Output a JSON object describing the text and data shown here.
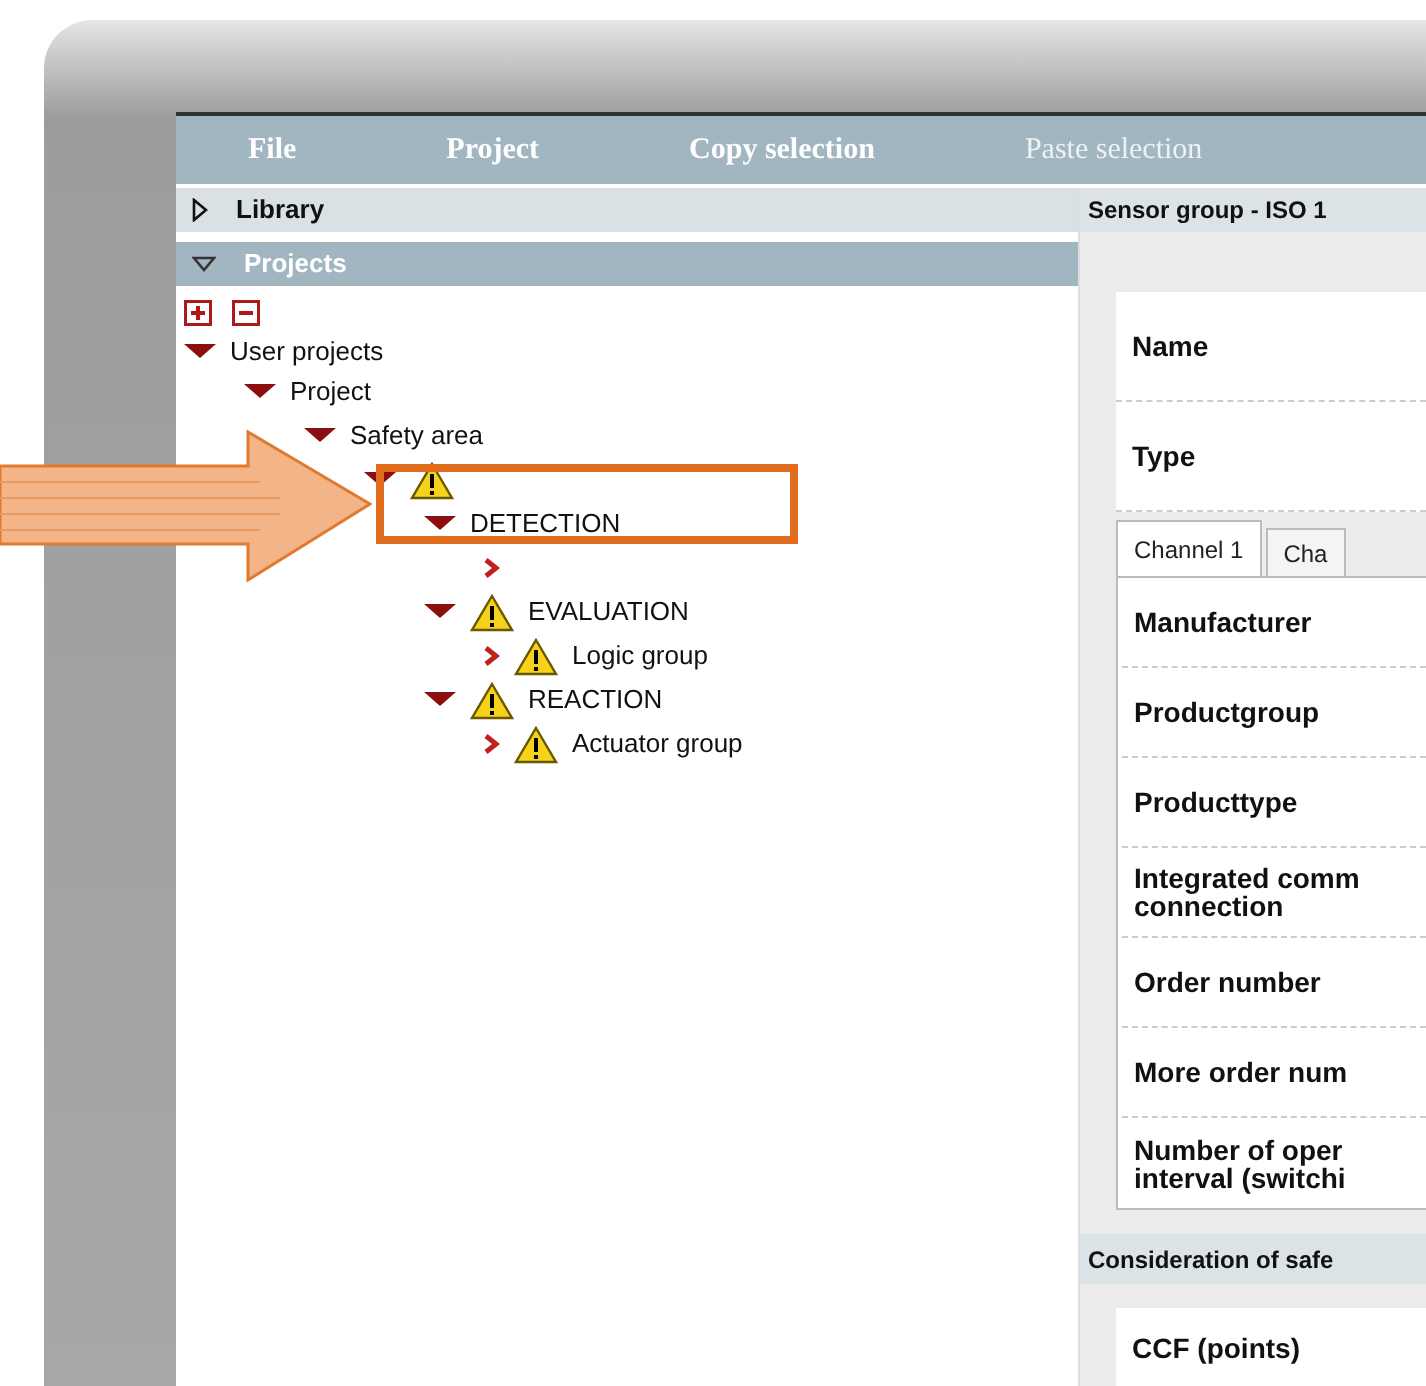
{
  "menu": [
    {
      "label": "File",
      "disabled": false
    },
    {
      "label": "Project",
      "disabled": false
    },
    {
      "label": "Copy selection",
      "disabled": false
    },
    {
      "label": "Paste selection",
      "disabled": true
    }
  ],
  "sidebar": {
    "sections": [
      {
        "label": "Library",
        "expanded": false
      },
      {
        "label": "Projects",
        "expanded": true
      }
    ],
    "tree": [
      {
        "label": "User projects",
        "expanded": true,
        "warning": false,
        "children": [
          {
            "label": "Project",
            "expanded": true,
            "warning": false,
            "children": [
              {
                "label": "Safety area",
                "expanded": true,
                "warning": false,
                "children": [
                  {
                    "expanded": true,
                    "warning": true,
                    "children": [
                      {
                        "label": "DETECTION",
                        "expanded": true,
                        "warning": false,
                        "children": [
                          {
                            "expanded": false,
                            "warning": false
                          }
                        ]
                      },
                      {
                        "label": "EVALUATION",
                        "expanded": true,
                        "warning": true,
                        "children": [
                          {
                            "label": "Logic group",
                            "expanded": false,
                            "warning": true
                          }
                        ]
                      },
                      {
                        "label": "REACTION",
                        "expanded": true,
                        "warning": true,
                        "children": [
                          {
                            "label": "Actuator group",
                            "expanded": false,
                            "warning": true
                          }
                        ]
                      }
                    ]
                  }
                ]
              }
            ]
          }
        ]
      }
    ]
  },
  "detail": {
    "title": "Sensor group - ISO 1",
    "fields": [
      "Name",
      "Type"
    ],
    "tabs": [
      {
        "label": "Channel 1",
        "selected": true
      },
      {
        "label": "Cha",
        "selected": false
      }
    ],
    "channel_fields": [
      "Manufacturer",
      "Productgroup",
      "Producttype",
      "Integrated comm\nconnection",
      "Order number",
      "More order num",
      "Number of oper\ninterval (switchi"
    ],
    "section": "Consideration of safe",
    "section_fields": [
      "CCF (points)"
    ]
  }
}
